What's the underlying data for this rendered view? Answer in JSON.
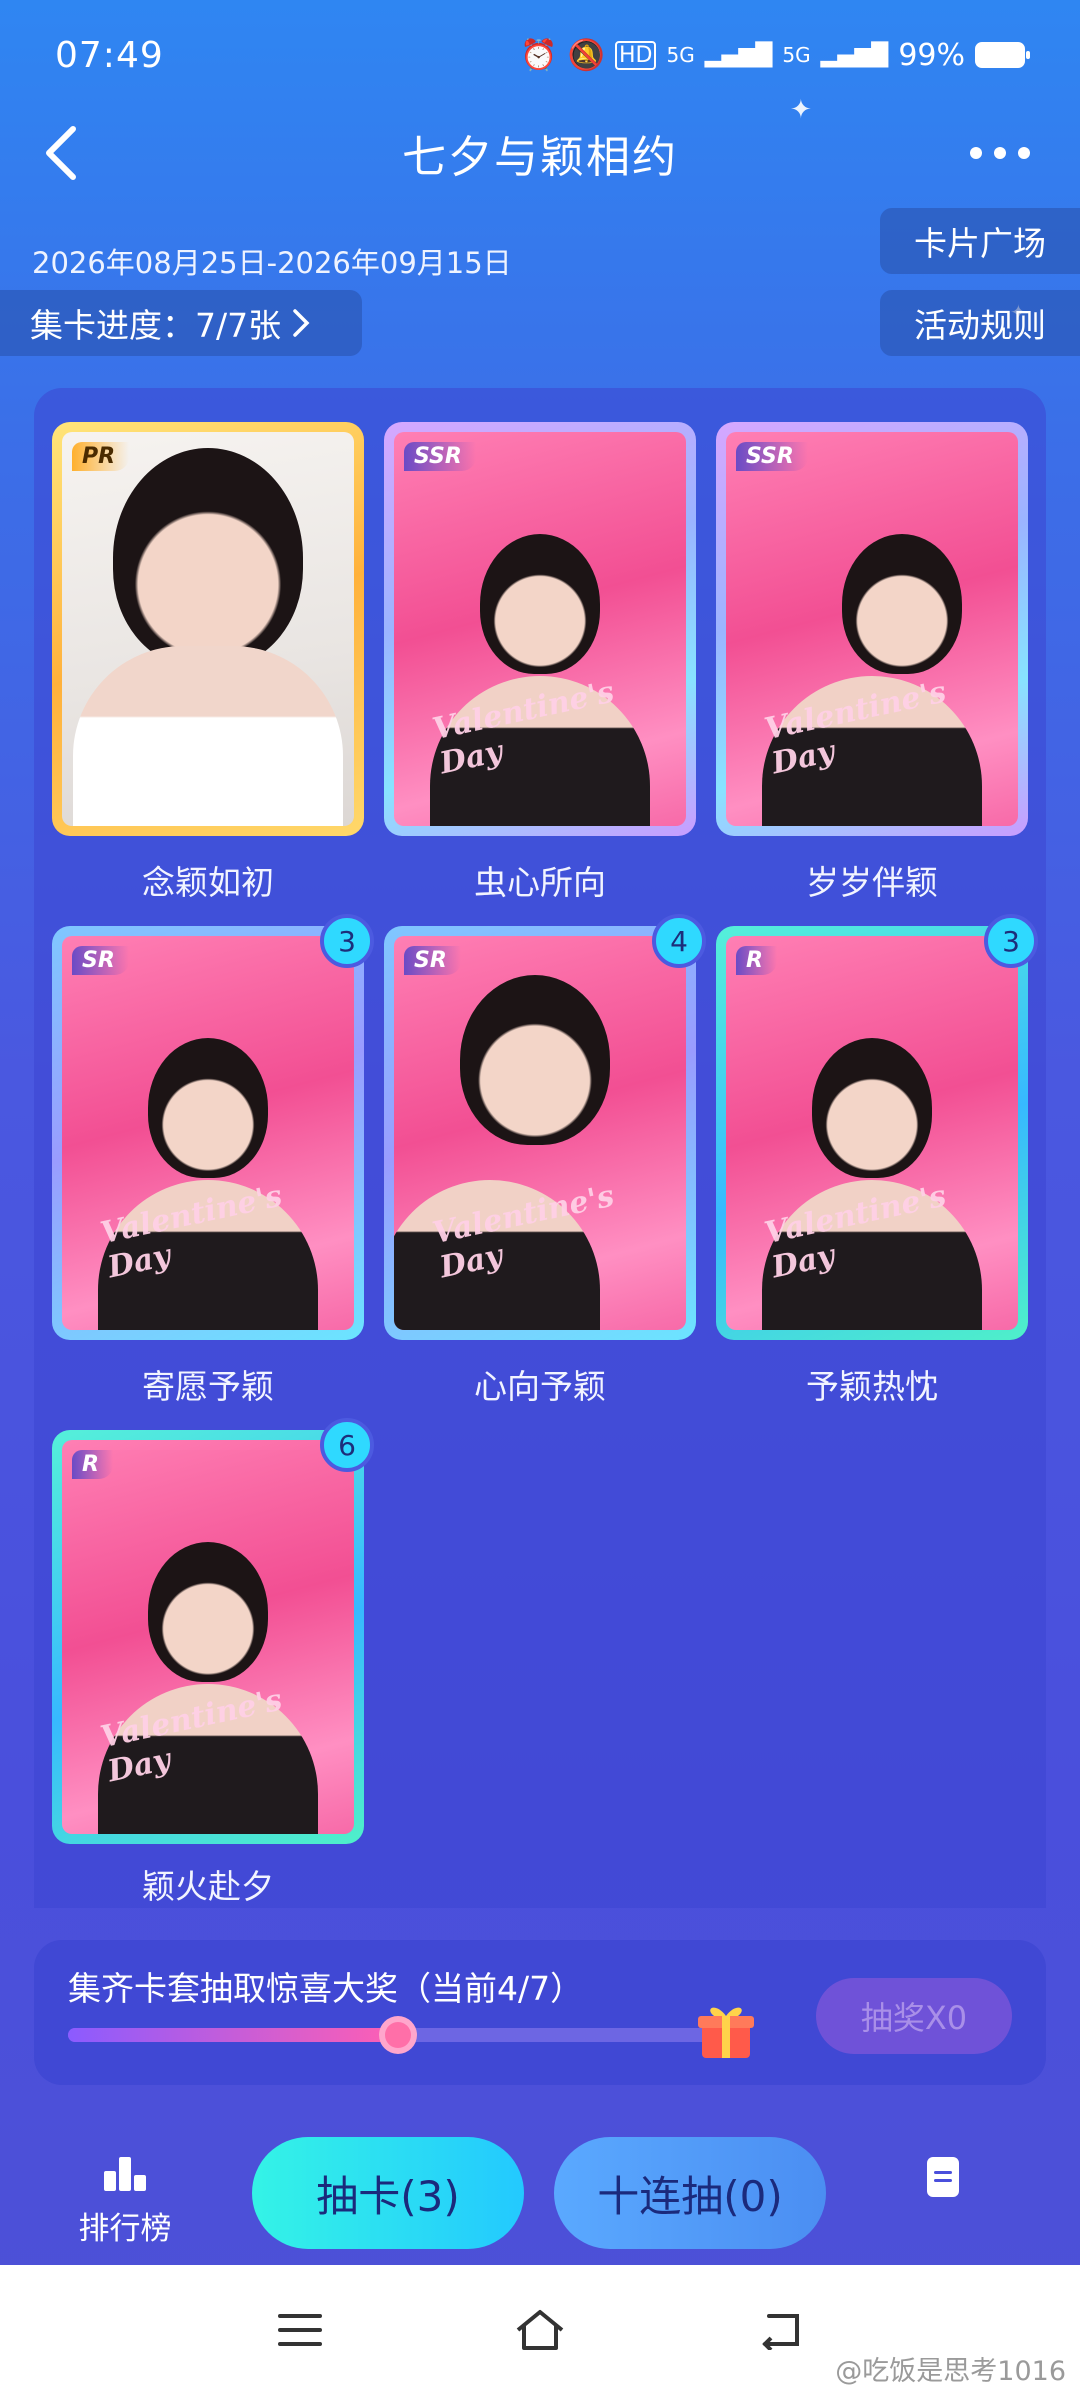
{
  "status_bar": {
    "time": "07:49",
    "network1": "5G",
    "network2": "5G",
    "battery": "99%"
  },
  "header": {
    "title": "七夕与颖相约",
    "back_icon": "chevron-left-icon",
    "more_icon": "more-dots-icon"
  },
  "event": {
    "date_range": "2026年08月25日-2026年09月15日",
    "progress_label": "集卡进度：7/7张",
    "card_square_label": "卡片广场",
    "rules_label": "活动规则"
  },
  "cards": [
    {
      "name": "念颖如初",
      "rarity": "PR",
      "count": ""
    },
    {
      "name": "虫心所向",
      "rarity": "SSR",
      "count": ""
    },
    {
      "name": "岁岁伴颖",
      "rarity": "SSR",
      "count": ""
    },
    {
      "name": "寄愿予颖",
      "rarity": "SR",
      "count": "3"
    },
    {
      "name": "心向予颖",
      "rarity": "SR",
      "count": "4"
    },
    {
      "name": "予颖热忱",
      "rarity": "R",
      "count": "3"
    },
    {
      "name": "颖火赴夕",
      "rarity": "R",
      "count": "6"
    }
  ],
  "reward": {
    "text": "集齐卡套抽取惊喜大奖（当前4/7）",
    "progress_fraction": 0.5,
    "lottery_label": "抽奖X0",
    "gift_icon": "gift-icon"
  },
  "actions": {
    "rank_label": "排行榜",
    "draw_label": "抽卡(3)",
    "ten_draw_label": "十连抽(0)",
    "doc_icon": "document-icon"
  },
  "nav": {
    "watermark": "@吃饭是思考1016"
  },
  "colors": {
    "accent_cyan": "#2fd9ff",
    "lottery_disabled": "#6f52d8"
  }
}
